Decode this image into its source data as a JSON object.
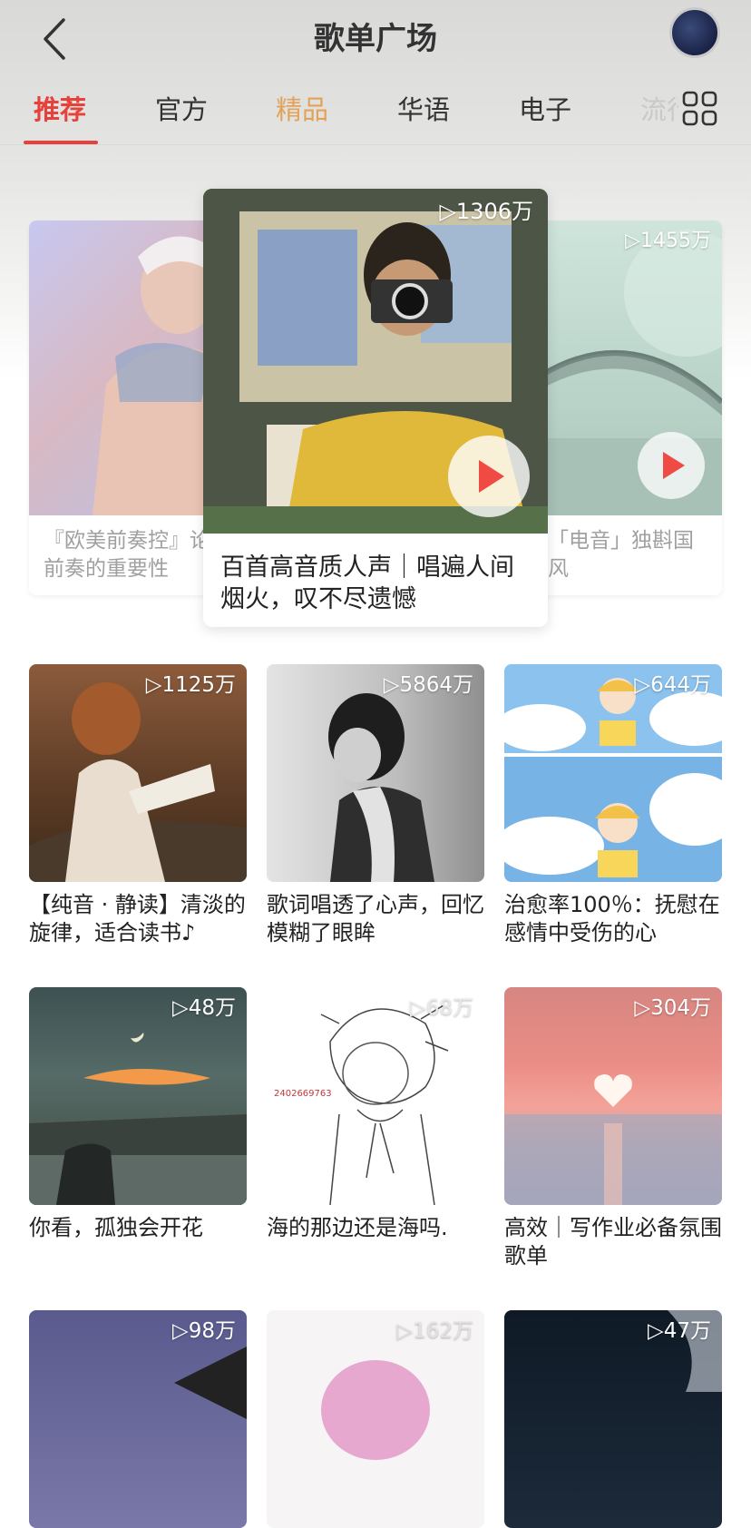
{
  "header": {
    "title": "歌单广场",
    "back_icon": "back-arrow-icon",
    "avatar_icon": "user-avatar"
  },
  "tabs": [
    {
      "label": "推荐",
      "state": "active"
    },
    {
      "label": "官方",
      "state": "normal"
    },
    {
      "label": "精品",
      "state": "highlight"
    },
    {
      "label": "华语",
      "state": "normal"
    },
    {
      "label": "电子",
      "state": "normal"
    },
    {
      "label": "流行",
      "state": "faded"
    }
  ],
  "carousel": {
    "left": {
      "title": "『欧美前奏控』论前奏的重要性"
    },
    "center": {
      "play_count": "1306万",
      "title": "百首高音质人声｜唱遍人间烟火，叹不尽遗憾"
    },
    "right": {
      "play_count": "1455万",
      "title": "「电音」独斟国风"
    }
  },
  "playlists": [
    {
      "play_count": "1125万",
      "title": "【纯音 · 静读】清淡的旋律，适合读书♪"
    },
    {
      "play_count": "5864万",
      "title": "歌词唱透了心声，回忆模糊了眼眸"
    },
    {
      "play_count": "644万",
      "title": "治愈率100％：抚慰在感情中受伤的心"
    },
    {
      "play_count": "48万",
      "title": "你看，孤独会开花"
    },
    {
      "play_count": "68万",
      "title": "海的那边还是海吗."
    },
    {
      "play_count": "304万",
      "title": "高效｜写作业必备氛围歌单"
    },
    {
      "play_count": "98万",
      "title": ""
    },
    {
      "play_count": "162万",
      "title": ""
    },
    {
      "play_count": "47万",
      "title": ""
    }
  ],
  "colors": {
    "accent": "#e6413a",
    "highlight_tab": "#e3a25a"
  }
}
